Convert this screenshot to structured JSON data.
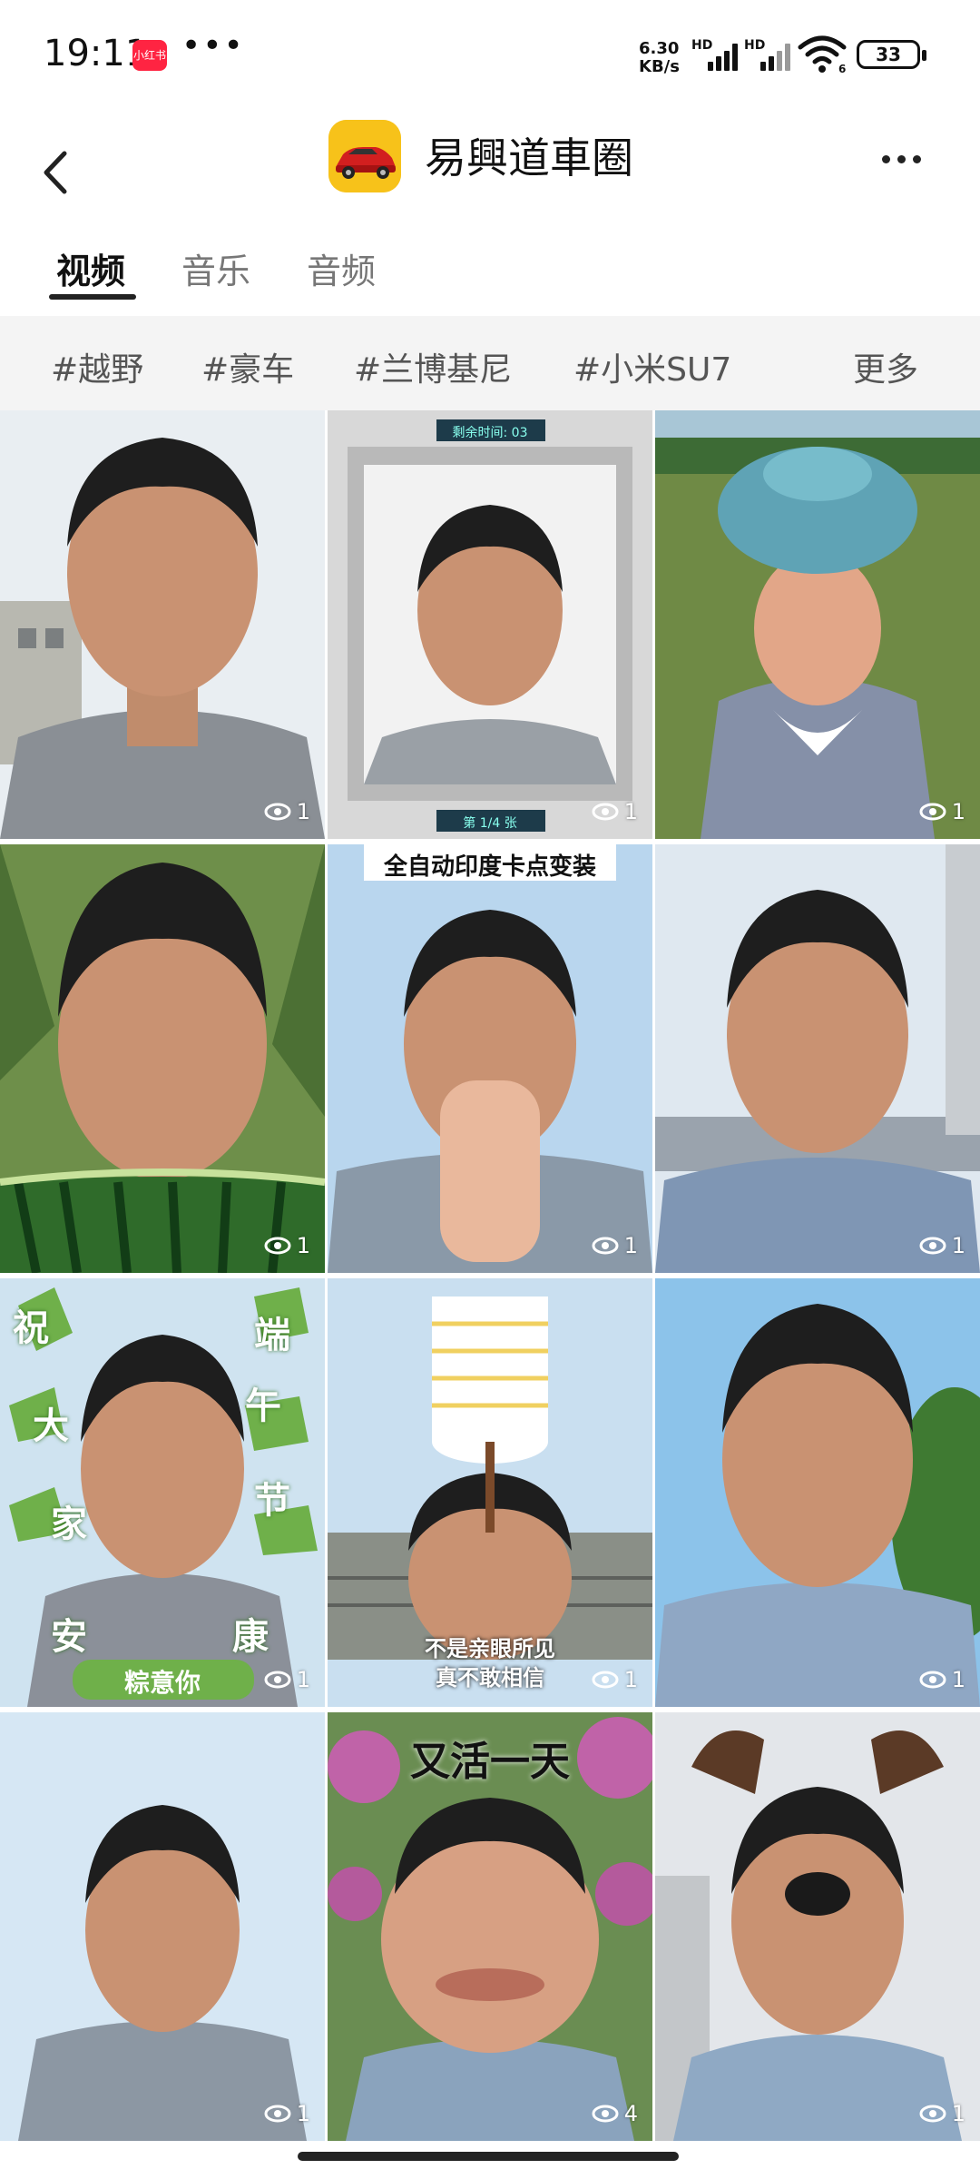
{
  "status_bar": {
    "time": "19:11",
    "app_badge": "小红书",
    "net_speed_top": "6.30",
    "net_speed_bottom": "KB/s",
    "sig1_label": "HD",
    "sig2_label": "HD",
    "wifi_label": "6",
    "battery": "33"
  },
  "header": {
    "title": "易興道車圈",
    "logo_icon": "red-car-icon"
  },
  "tabs": [
    {
      "label": "视频",
      "active": true
    },
    {
      "label": "音乐",
      "active": false
    },
    {
      "label": "音频",
      "active": false
    }
  ],
  "tags": [
    "#越野",
    "#豪车",
    "#兰博基尼",
    "#小米SU7"
  ],
  "tags_more": "更多",
  "grid": [
    {
      "views": "1",
      "scene": "building"
    },
    {
      "views": "1",
      "scene": "frame",
      "overlay_top": "剩余时间: 03",
      "overlay_bottom": "第 1/4 张"
    },
    {
      "views": "1",
      "scene": "field-cartoon"
    },
    {
      "views": "1",
      "scene": "corn-watermelon"
    },
    {
      "views": "1",
      "scene": "sky-hands",
      "caption_top": "全自动印度卡点变装"
    },
    {
      "views": "1",
      "scene": "street"
    },
    {
      "views": "1",
      "scene": "dragonboat",
      "side_text": [
        "祝",
        "端",
        "午",
        "大",
        "家",
        "节",
        "安",
        "康"
      ],
      "banner": "粽意你"
    },
    {
      "views": "1",
      "scene": "bowls",
      "caption_lines": [
        "不是亲眼所见",
        "真不敢相信"
      ]
    },
    {
      "views": "1",
      "scene": "trees"
    },
    {
      "views": "1",
      "scene": "sky"
    },
    {
      "views": "4",
      "scene": "flowers",
      "caption_top": "又活一天"
    },
    {
      "views": "1",
      "scene": "dog-filter"
    }
  ],
  "colors": {
    "accent": "#ff2442",
    "logo_bg": "#f7c21a",
    "tagbar_bg": "#f4f4f4"
  }
}
